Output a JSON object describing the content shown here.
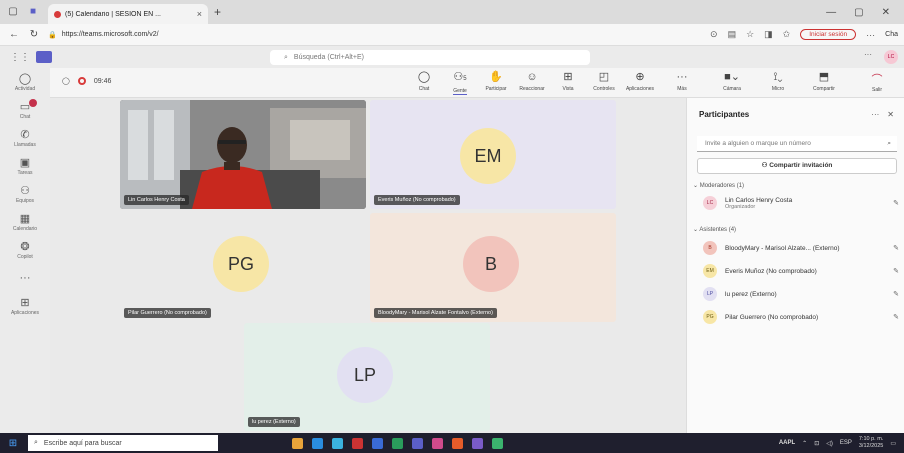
{
  "browser": {
    "tab_title": "(5) Calendario | SESION EN ...",
    "url": "https://teams.microsoft.com/v2/",
    "sesion_label": "Iniciar sesión",
    "chat_label": "Cha"
  },
  "appbar": {
    "search_placeholder": "Búsqueda (Ctrl+Alt+E)",
    "user_initials": "LC"
  },
  "rail": {
    "items": [
      {
        "label": "Actividad",
        "icon": "bell-icon"
      },
      {
        "label": "Chat",
        "icon": "chat-icon"
      },
      {
        "label": "Llamadas",
        "icon": "phone-icon"
      },
      {
        "label": "Tareas",
        "icon": "tasks-icon"
      },
      {
        "label": "Equipos",
        "icon": "teams-icon"
      },
      {
        "label": "Calendario",
        "icon": "calendar-icon"
      },
      {
        "label": "Copilot",
        "icon": "copilot-icon"
      },
      {
        "label": "",
        "icon": "more-icon"
      },
      {
        "label": "Aplicaciones",
        "icon": "apps-icon"
      }
    ]
  },
  "meeting": {
    "timer": "09:46",
    "people_count": "5",
    "toolbar": [
      {
        "label": "Chat",
        "icon": "chat-icon"
      },
      {
        "label": "Gente",
        "icon": "people-icon"
      },
      {
        "label": "Participar",
        "icon": "raise-hand-icon"
      },
      {
        "label": "Reaccionar",
        "icon": "emoji-icon"
      },
      {
        "label": "Vista",
        "icon": "view-icon"
      },
      {
        "label": "Controles",
        "icon": "controls-icon"
      },
      {
        "label": "Aplicaciones",
        "icon": "apps-icon"
      },
      {
        "label": "Más",
        "icon": "more-icon"
      },
      {
        "label": "Cámara",
        "icon": "camera-icon"
      },
      {
        "label": "Micro",
        "icon": "mic-icon"
      },
      {
        "label": "Compartir",
        "icon": "share-icon"
      }
    ],
    "leave_label": "Salir"
  },
  "tiles": [
    {
      "name": "Lin Carlos Henry Costa",
      "initials": "",
      "bg": "#5a5a5a",
      "avatar_bg": ""
    },
    {
      "name": "Everis Muñoz (No comprobado)",
      "initials": "EM",
      "bg": "#e7e4f2",
      "avatar_bg": "#f7e6a6"
    },
    {
      "name": "Pilar Guerrero (No comprobado)",
      "initials": "PG",
      "bg": "#eaeaea",
      "avatar_bg": "#f7e6a6"
    },
    {
      "name": "BloodyMary - Marisol Alzate Fontalvo (Externo)",
      "initials": "B",
      "bg": "#f3e6dc",
      "avatar_bg": "#f2c4bc"
    },
    {
      "name": "lu perez (Externo)",
      "initials": "LP",
      "bg": "#e3efe9",
      "avatar_bg": "#e2e0f2"
    }
  ],
  "panel": {
    "title": "Participantes",
    "invite_placeholder": "Invite a alguien o marque un número",
    "share_label": "Compartir invitación",
    "organizers_header": "Moderadores (1)",
    "attendees_header": "Asistentes (4)",
    "organizers": [
      {
        "name": "Lin Carlos Henry Costa",
        "role": "Organizador",
        "initials": "LC",
        "avatar_bg": "#f6d0d8",
        "avatar_fg": "#a02040"
      }
    ],
    "attendees": [
      {
        "name": "BloodyMary - Marisol Alzate... (Externo)",
        "initials": "B",
        "avatar_bg": "#f2c4bc",
        "avatar_fg": "#a03020"
      },
      {
        "name": "Everis Muñoz (No comprobado)",
        "initials": "EM",
        "avatar_bg": "#f7e6a6",
        "avatar_fg": "#6a5a10"
      },
      {
        "name": "lu perez (Externo)",
        "initials": "LP",
        "avatar_bg": "#e2e0f2",
        "avatar_fg": "#4a4aa0"
      },
      {
        "name": "Pilar Guerrero (No comprobado)",
        "initials": "PG",
        "avatar_bg": "#f7e6a6",
        "avatar_fg": "#6a5a10"
      }
    ]
  },
  "taskbar": {
    "search_placeholder": "Escribe aquí para buscar",
    "stock_label": "AAPL",
    "language": "ESP",
    "time": "7:10 p. m.",
    "date": "3/12/2025"
  }
}
